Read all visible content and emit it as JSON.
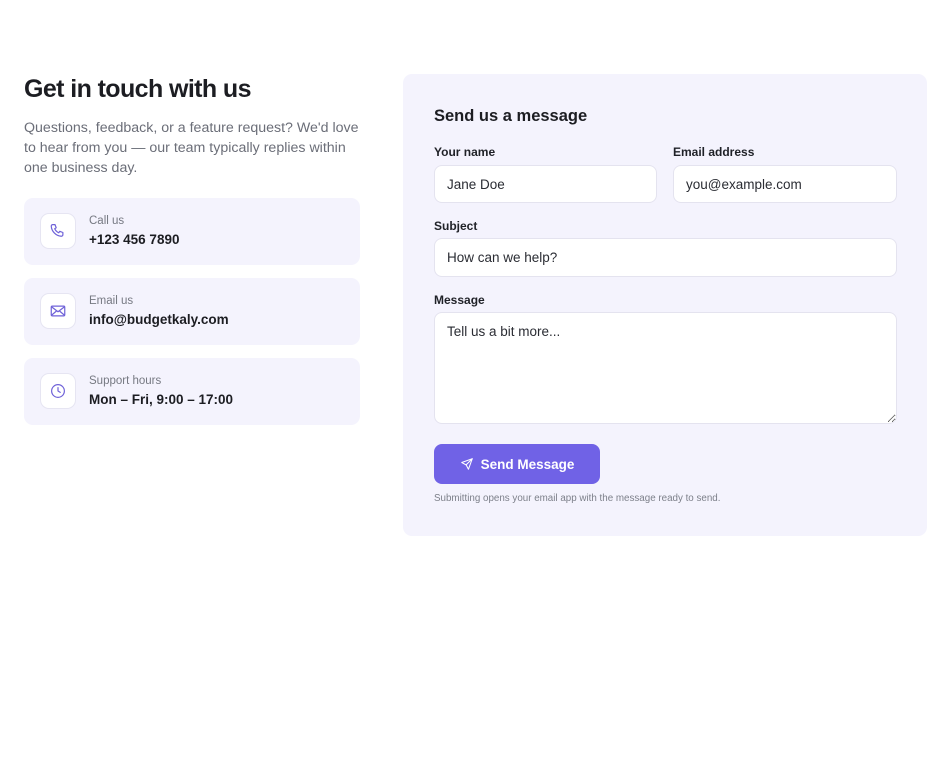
{
  "left": {
    "title": "Get in touch with us",
    "intro": "Questions, feedback, or a feature request? We'd love to hear from you — our team typically replies within one business day.",
    "cards": [
      {
        "icon": "phone-icon",
        "label": "Call us",
        "value": "+123 456 7890"
      },
      {
        "icon": "mail-icon",
        "label": "Email us",
        "value": "info@budgetkaly.com"
      },
      {
        "icon": "clock-icon",
        "label": "Support hours",
        "value": "Mon – Fri, 9:00 – 17:00"
      }
    ]
  },
  "form": {
    "title": "Send us a message",
    "name_label": "Your name",
    "name_placeholder": "Jane Doe",
    "email_label": "Email address",
    "email_placeholder": "you@example.com",
    "subject_label": "Subject",
    "subject_placeholder": "How can we help?",
    "message_label": "Message",
    "message_placeholder": "Tell us a bit more...",
    "submit_label": "Send Message",
    "hint": "Submitting opens your email app with the message ready to send."
  },
  "colors": {
    "accent": "#7062e6",
    "panel_bg": "#f4f3fd",
    "icon_stroke": "#6f62d8"
  }
}
